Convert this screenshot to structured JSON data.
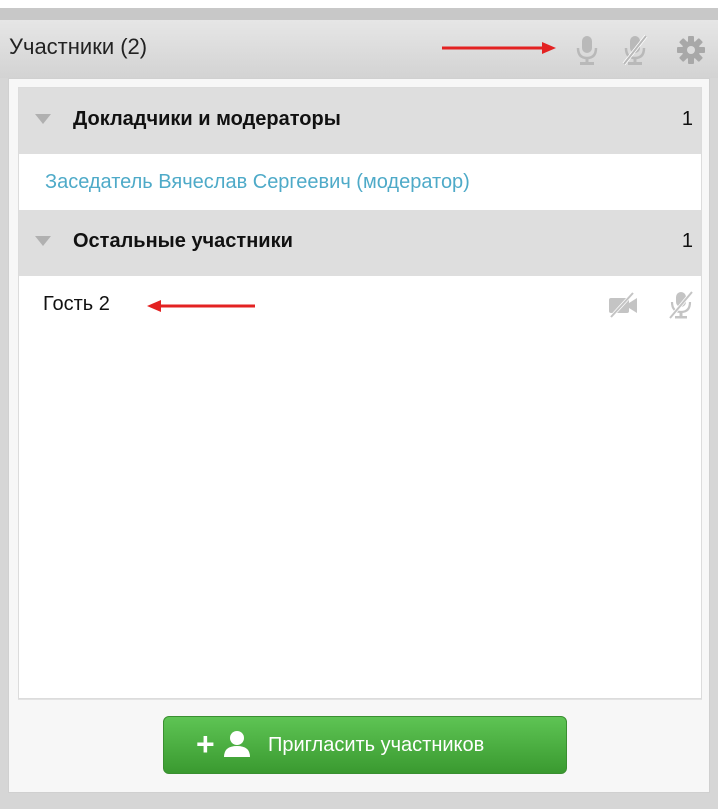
{
  "header": {
    "title": "Участники (2)",
    "icons": [
      "microphone-icon",
      "microphone-muted-icon",
      "gear-icon"
    ]
  },
  "groups": [
    {
      "label": "Докладчики и модераторы",
      "count": "1",
      "members": [
        {
          "name": "Заседатель Вячеслав Сергеевич (модератор)",
          "role": "moderator",
          "color": "#4eaac8"
        }
      ]
    },
    {
      "label": "Остальные участники",
      "count": "1",
      "members": [
        {
          "name": "Гость 2",
          "role": "guest",
          "icons": [
            "camera-off-icon",
            "microphone-muted-icon"
          ]
        }
      ]
    }
  ],
  "footer": {
    "invite_label": "Пригласить участников",
    "invite_icon": "add-person-icon"
  },
  "colors": {
    "accent_green": "#4caf50",
    "moderator_text": "#4eaac8",
    "annotation_arrow": "#e32222"
  }
}
